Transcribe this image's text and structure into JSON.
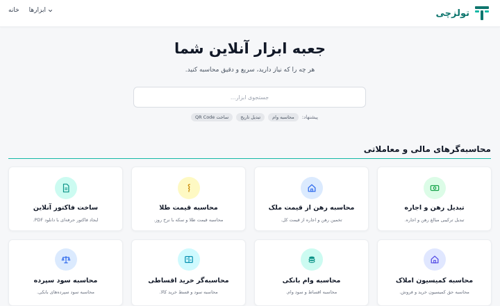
{
  "header": {
    "logo_text": "تولزچی",
    "nav": {
      "home": "خانه",
      "tools": "ابزارها"
    }
  },
  "hero": {
    "title": "جعبه ابزار آنلاین شما",
    "subtitle": "هر چه را که نیاز دارید، سریع و دقیق محاسبه کنید."
  },
  "search": {
    "placeholder": "جستجوی ابزار..."
  },
  "suggestions": {
    "label": "پیشنهاد:",
    "chips": [
      "محاسبه وام",
      "تبدیل تاریخ",
      "ساخت QR Code"
    ]
  },
  "section": {
    "title": "محاسبه‌گرهای مالی و معاملاتی"
  },
  "cards": [
    {
      "title": "تبدیل رهن و اجاره",
      "desc": "تبدیل ترکیبی مبالغ رهن و اجاره.",
      "icon": "money-icon",
      "color": "#dcfce7",
      "icon_color": "#16a34a"
    },
    {
      "title": "محاسبه رهن از قیمت ملک",
      "desc": "تخمین رهن و اجاره از قیمت کل.",
      "icon": "home-icon",
      "color": "#dbeafe",
      "icon_color": "#2563eb"
    },
    {
      "title": "محاسبه قیمت طلا",
      "desc": "محاسبه قیمت طلا و سکه با نرخ روز.",
      "icon": "gold-icon",
      "color": "#fef9c3",
      "icon_color": "#ca8a04"
    },
    {
      "title": "ساخت فاکتور آنلاین",
      "desc": "ایجاد فاکتور حرفه‌ای با دانلود PDF.",
      "icon": "document-icon",
      "color": "#ccfbf1",
      "icon_color": "#0d9488"
    },
    {
      "title": "محاسبه کمیسیون املاک",
      "desc": "محاسبه حق کمیسیون خرید و فروش.",
      "icon": "house-icon",
      "color": "#e0e7ff",
      "icon_color": "#4f46e5"
    },
    {
      "title": "محاسبه وام بانکی",
      "desc": "محاسبه اقساط و سود وام.",
      "icon": "coin-icon",
      "color": "#ccfbf1",
      "icon_color": "#0d9488"
    },
    {
      "title": "محاسبه‌گر خرید اقساطی",
      "desc": "محاسبه سود و قسط خرید کالا.",
      "icon": "calculator-icon",
      "color": "#cffafe",
      "icon_color": "#0891b2"
    },
    {
      "title": "محاسبه سود سپرده",
      "desc": "محاسبه سود سپرده‌های بانکی.",
      "icon": "scale-icon",
      "color": "#dbeafe",
      "icon_color": "#2563eb"
    }
  ],
  "colors": {
    "accent": "#0f766e",
    "divider": "#14b8a6"
  }
}
